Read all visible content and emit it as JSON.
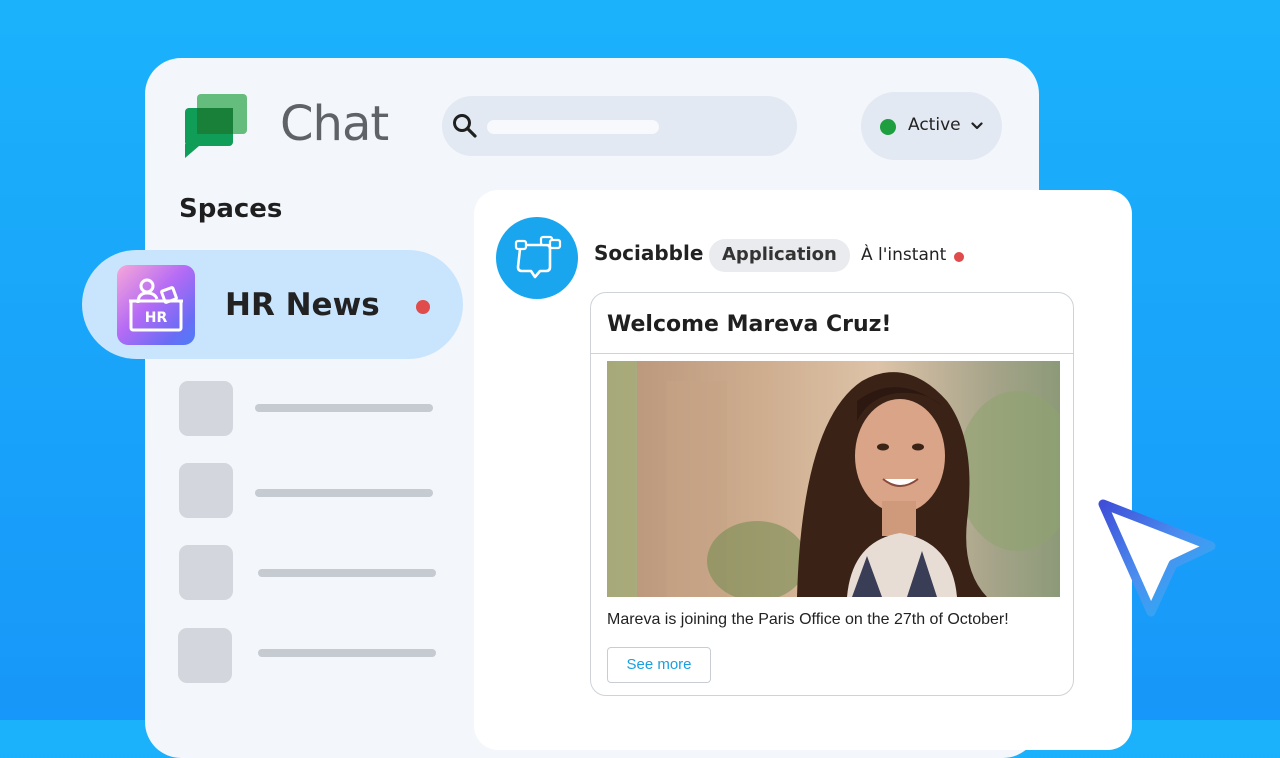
{
  "colors": {
    "background": "#1aa8fb",
    "window": "#f3f6fb",
    "selected_space": "#c8e5fd",
    "active_status": "#1e9e3e",
    "unread": "#e04b4b",
    "link": "#1aa0e0"
  },
  "header": {
    "app_title": "Chat",
    "logo_icon": "google-chat-logo-icon",
    "search": {
      "icon": "search-icon",
      "placeholder": ""
    },
    "status": {
      "label": "Active",
      "icon": "chevron-down-icon"
    }
  },
  "sidebar": {
    "heading": "Spaces",
    "selected_space": {
      "label": "HR News",
      "icon": "hr-desk-icon",
      "unread": true
    },
    "placeholder_spaces": 4
  },
  "message": {
    "sender": "Sociabble",
    "avatar_icon": "speech-bubbles-icon",
    "badge": "Application",
    "timestamp": "À l'instant",
    "unread": true,
    "card": {
      "title": "Welcome Mareva Cruz!",
      "image": "portrait-photo-smiling-woman",
      "description": "Mareva is joining the Paris Office on the 27th of October!",
      "button_label": "See more"
    }
  },
  "cursor_icon": "pointer-cursor-icon"
}
